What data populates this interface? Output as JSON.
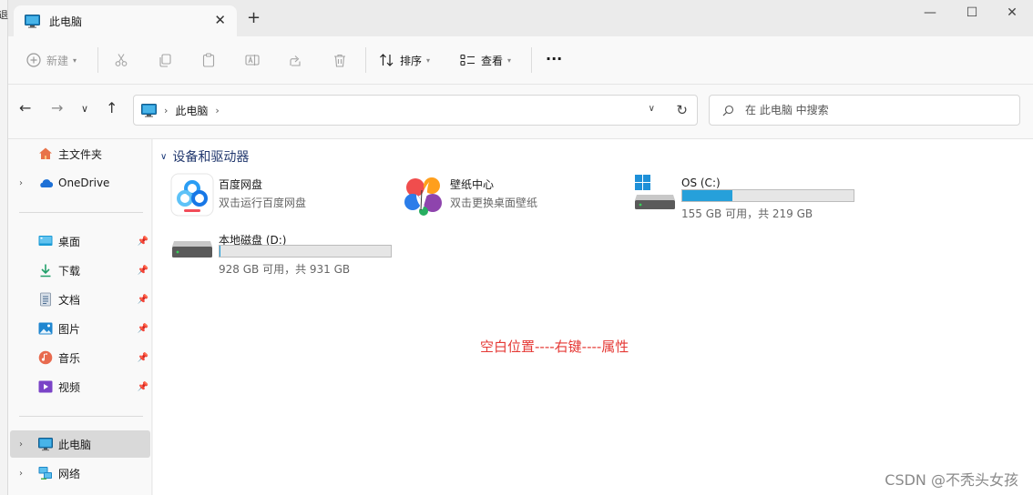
{
  "colors": {
    "accent": "#26a0da",
    "note": "#e53935",
    "folder_title": "#22386e"
  },
  "left_strip": {
    "text": "退"
  },
  "tab": {
    "title": "此电脑",
    "icon": "monitor-icon",
    "close": "✕",
    "add": "+"
  },
  "window_controls": {
    "minimize": "—",
    "maximize": "☐",
    "close": "✕"
  },
  "toolbar": {
    "new_label": "新建",
    "sort_label": "排序",
    "view_label": "查看",
    "more_label": "···"
  },
  "address": {
    "location": "此电脑"
  },
  "search": {
    "placeholder": "在 此电脑 中搜索"
  },
  "sidebar": {
    "items": [
      {
        "label": "主文件夹",
        "icon": "home-icon"
      },
      {
        "label": "OneDrive",
        "icon": "cloud-icon"
      },
      {
        "label": "桌面",
        "icon": "desktop-icon"
      },
      {
        "label": "下载",
        "icon": "download-icon"
      },
      {
        "label": "文档",
        "icon": "document-icon"
      },
      {
        "label": "图片",
        "icon": "picture-icon"
      },
      {
        "label": "音乐",
        "icon": "music-icon"
      },
      {
        "label": "视频",
        "icon": "video-icon"
      },
      {
        "label": "此电脑",
        "icon": "monitor-icon"
      },
      {
        "label": "网络",
        "icon": "network-icon"
      }
    ]
  },
  "content": {
    "group_title": "设备和驱动器",
    "apps": [
      {
        "name": "百度网盘",
        "desc": "双击运行百度网盘",
        "icon": "baidu-netdisk-icon"
      },
      {
        "name": "壁纸中心",
        "desc": "双击更换桌面壁纸",
        "icon": "wallpaper-center-icon"
      }
    ],
    "drives": [
      {
        "name": "OS (C:)",
        "usage": "155 GB 可用，共 219 GB",
        "used_fraction": 0.29,
        "icon": "windows-drive-icon"
      },
      {
        "name": "本地磁盘 (D:)",
        "usage": "928 GB 可用，共 931 GB",
        "used_fraction": 0.003,
        "icon": "hard-drive-icon"
      }
    ],
    "note": "空白位置----右键----属性"
  },
  "watermark": "CSDN @不秃头女孩"
}
